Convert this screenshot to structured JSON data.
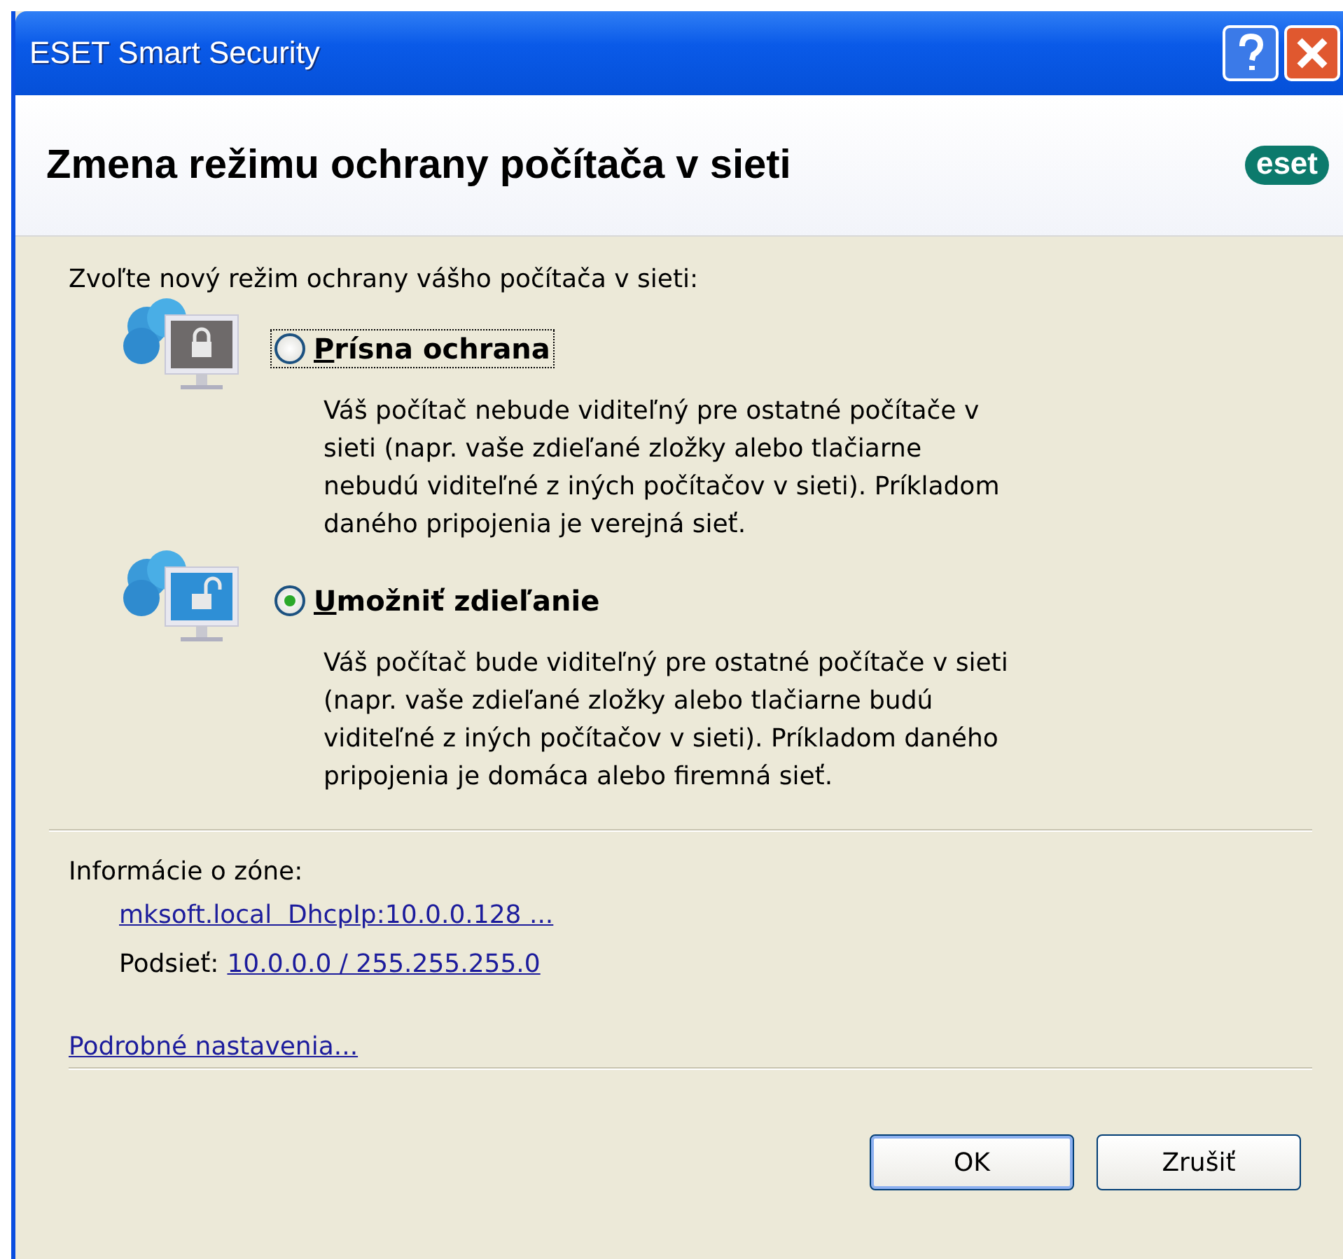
{
  "window": {
    "title": "ESET Smart Security"
  },
  "header": {
    "title": "Zmena režimu ochrany počítača v sieti",
    "logo": "eset"
  },
  "prompt": "Zvoľte nový režim ochrany vášho počítača v sieti:",
  "options": [
    {
      "kind": "strict",
      "label": "Prísna ochrana",
      "selected": false,
      "focused": true,
      "description": "Váš počítač nebude viditeľný pre ostatné počítače v sieti (napr. vaše zdieľané zložky alebo tlačiarne nebudú viditeľné z iných počítačov v sieti). Príkladom daného pripojenia je verejná sieť."
    },
    {
      "kind": "sharing",
      "label": "Umožniť zdieľanie",
      "selected": true,
      "focused": false,
      "description": "Váš počítač bude viditeľný pre ostatné počítače v sieti (napr. vaše zdieľané zložky alebo tlačiarne budú viditeľné z iných počítačov v sieti). Príkladom daného pripojenia je domáca alebo firemná sieť."
    }
  ],
  "zone": {
    "label": "Informácie o zóne:",
    "link": "mksoft.local  DhcpIp:10.0.0.128 ...",
    "subnet_label": "Podsieť:",
    "subnet_link": "10.0.0.0 / 255.255.255.0"
  },
  "advanced_link": "Podrobné nastavenia...",
  "buttons": [
    {
      "label": "OK",
      "default": true
    },
    {
      "label": "Zrušiť",
      "default": false
    }
  ]
}
